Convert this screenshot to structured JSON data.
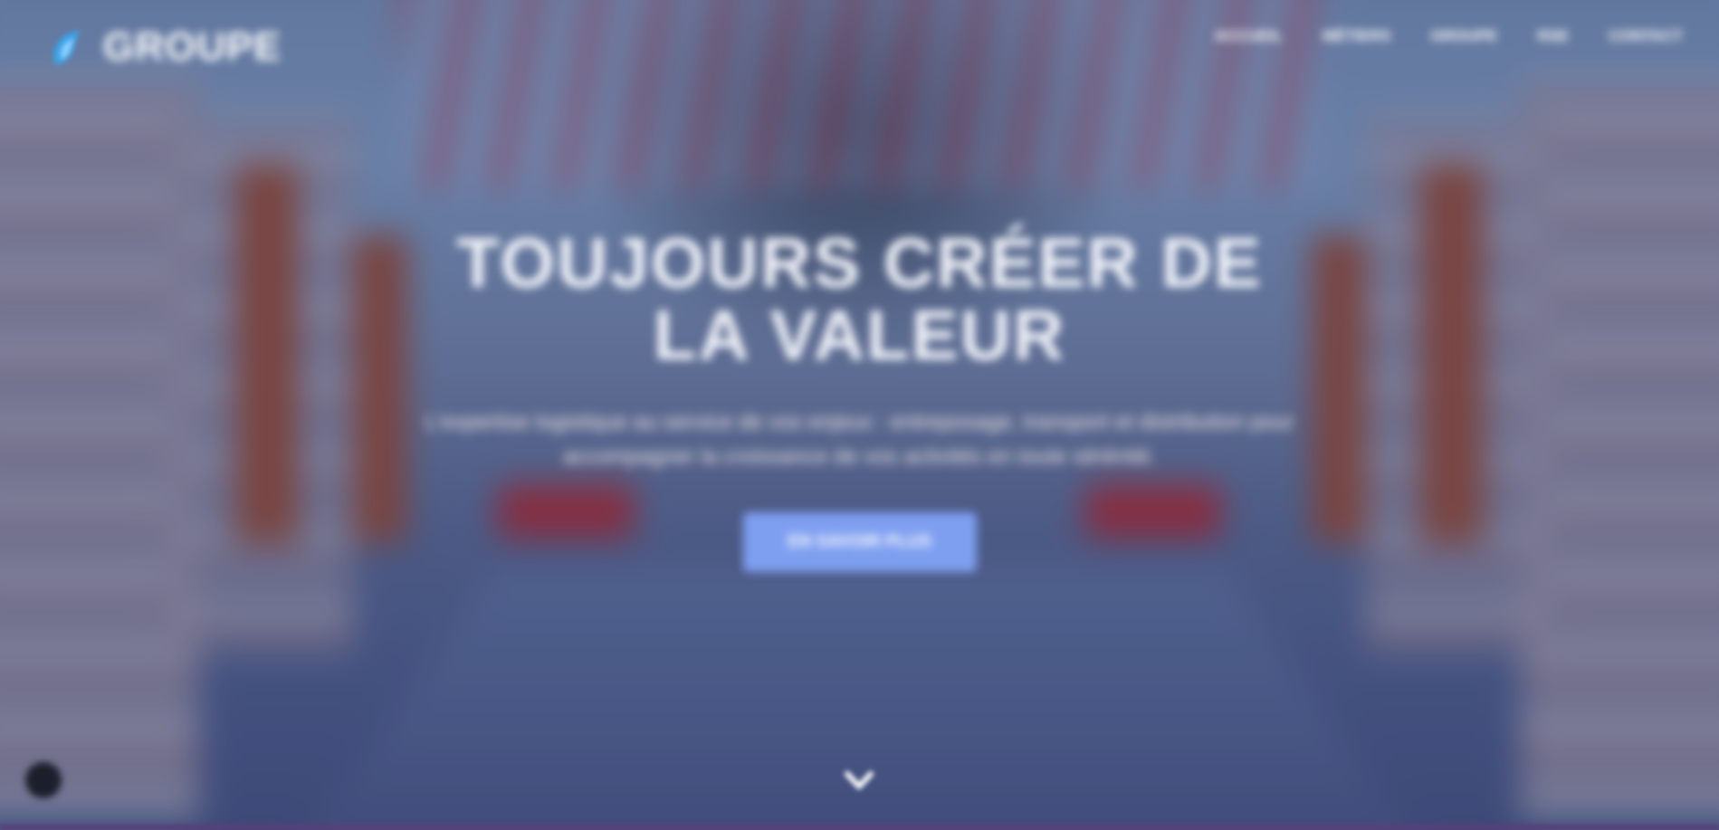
{
  "header": {
    "logo_text": "GROUPE",
    "nav": [
      {
        "label": "ACCUEIL"
      },
      {
        "label": "MÉTIERS"
      },
      {
        "label": "GROUPE"
      },
      {
        "label": "RSE"
      },
      {
        "label": "CONTACT"
      }
    ]
  },
  "hero": {
    "title": "TOUJOURS CRÉER DE LA VALEUR",
    "description": "L'expertise logistique au service de vos enjeux : entreposage, transport et distribution pour accompagner la croissance de vos activités en toute sérénité.",
    "cta_label": "EN SAVOIR PLUS"
  },
  "colors": {
    "accent": "#7e9ef0",
    "overlay": "#4a5a85",
    "bottom_bar": "#5a3f7a"
  },
  "icons": {
    "logo": "logo-drop-icon",
    "scroll": "chevron-down-icon",
    "corner": "chat-bubble-icon"
  }
}
